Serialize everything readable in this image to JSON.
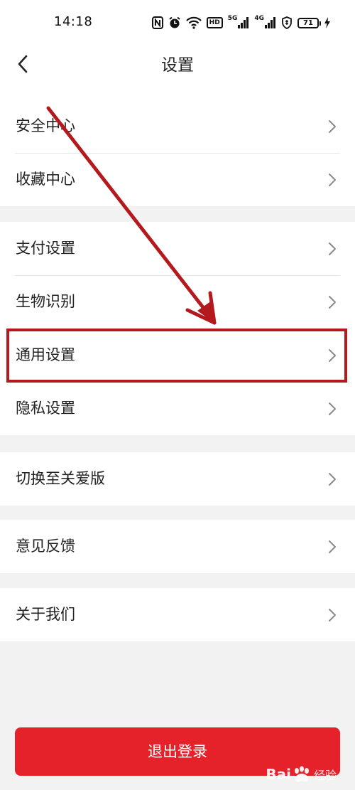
{
  "status_bar": {
    "time": "14:18",
    "icons": [
      "nfc-icon",
      "alarm-icon",
      "wifi-icon",
      "hd-icon",
      "5g-signal-icon",
      "4g-signal-icon",
      "shield-icon"
    ],
    "hd_label": "HD",
    "net_5g": "5G",
    "net_4g": "4G",
    "battery": "71"
  },
  "header": {
    "title": "设置"
  },
  "groups": [
    {
      "items": [
        {
          "label": "安全中心"
        },
        {
          "label": "收藏中心"
        }
      ]
    },
    {
      "items": [
        {
          "label": "支付设置"
        },
        {
          "label": "生物识别"
        },
        {
          "label": "通用设置"
        },
        {
          "label": "隐私设置"
        }
      ]
    },
    {
      "items": [
        {
          "label": "切换至关爱版"
        }
      ]
    },
    {
      "items": [
        {
          "label": "意见反馈"
        }
      ]
    },
    {
      "items": [
        {
          "label": "关于我们"
        }
      ]
    }
  ],
  "logout": {
    "label": "退出登录"
  },
  "watermark": {
    "text_a": "Bai",
    "text_b": "经验"
  },
  "colors": {
    "accent": "#e5212a",
    "annotation": "#b3191d",
    "background": "#f2f2f2"
  }
}
